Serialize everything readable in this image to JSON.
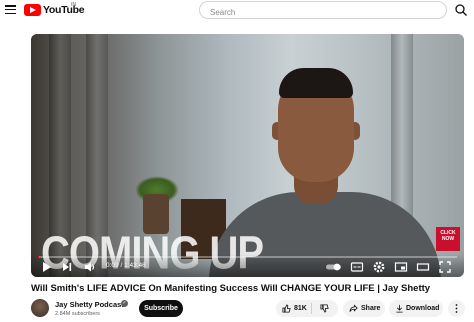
{
  "header": {
    "logo_text": "YouTube",
    "country_code": "IN",
    "search_placeholder": "Search"
  },
  "player": {
    "overlay_text": "COMING UP",
    "click_now_text": "CLICK NOW",
    "time_current": "0:09",
    "time_total": "1:43:46",
    "progress_fraction": 0.0015
  },
  "video": {
    "title": "Will Smith's LIFE ADVICE On Manifesting Success Will CHANGE YOUR LIFE | Jay Shetty",
    "channel_name": "Jay Shetty Podcast",
    "subscribers": "2.84M subscribers",
    "subscribe_label": "Subscribe",
    "like_count": "81K",
    "share_label": "Share",
    "download_label": "Download"
  },
  "colors": {
    "brand_red": "#ff0000",
    "button_dark": "#0f0f0f",
    "pill_bg": "#f2f2f2"
  },
  "icons": [
    "menu-icon",
    "youtube-logo-icon",
    "search-icon",
    "play-icon",
    "next-icon",
    "volume-icon",
    "autoplay-toggle-icon",
    "captions-icon",
    "settings-icon",
    "miniplayer-icon",
    "theater-icon",
    "fullscreen-icon",
    "verified-icon",
    "like-icon",
    "dislike-icon",
    "share-icon",
    "download-icon",
    "more-icon"
  ]
}
